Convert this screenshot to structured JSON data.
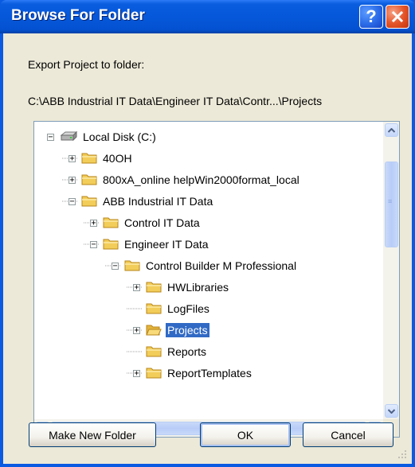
{
  "window": {
    "title": "Browse For Folder",
    "help_label": "?",
    "close_icon": "close-icon",
    "colors": {
      "titlebar": "#0A5AE2",
      "dialog_bg": "#ECE9D8",
      "selection": "#316AC5",
      "folder": "#F2CD59"
    }
  },
  "dialog": {
    "instruction": "Export Project  to folder:",
    "current_path": "C:\\ABB Industrial IT Data\\Engineer IT Data\\Contr...\\Projects"
  },
  "tree": {
    "items": [
      {
        "label": "Local Disk (C:)",
        "icon": "drive-icon",
        "expander": "−"
      },
      {
        "label": "40OH",
        "icon": "folder-icon",
        "expander": "+"
      },
      {
        "label": "800xA_online helpWin2000format_local",
        "icon": "folder-icon",
        "expander": "+"
      },
      {
        "label": "ABB Industrial IT Data",
        "icon": "folder-icon",
        "expander": "−"
      },
      {
        "label": "Control IT Data",
        "icon": "folder-icon",
        "expander": "+"
      },
      {
        "label": "Engineer IT Data",
        "icon": "folder-icon",
        "expander": "−"
      },
      {
        "label": "Control Builder M Professional",
        "icon": "folder-icon",
        "expander": "−"
      },
      {
        "label": "HWLibraries",
        "icon": "folder-icon",
        "expander": "+"
      },
      {
        "label": "LogFiles",
        "icon": "folder-icon",
        "expander": ""
      },
      {
        "label": "Projects",
        "icon": "open-folder-icon",
        "expander": "+",
        "selected": true
      },
      {
        "label": "Reports",
        "icon": "folder-icon",
        "expander": ""
      },
      {
        "label": "ReportTemplates",
        "icon": "folder-icon",
        "expander": "+"
      }
    ]
  },
  "scrollbars": {
    "vertical": {
      "up_icon": "arrow-up-icon",
      "down_icon": "arrow-down-icon",
      "grip": "≡"
    },
    "horizontal": {
      "left_icon": "arrow-left-icon",
      "right_icon": "arrow-right-icon",
      "grip": "|||"
    }
  },
  "buttons": {
    "make_new_folder": "Make New Folder",
    "ok": "OK",
    "cancel": "Cancel"
  }
}
